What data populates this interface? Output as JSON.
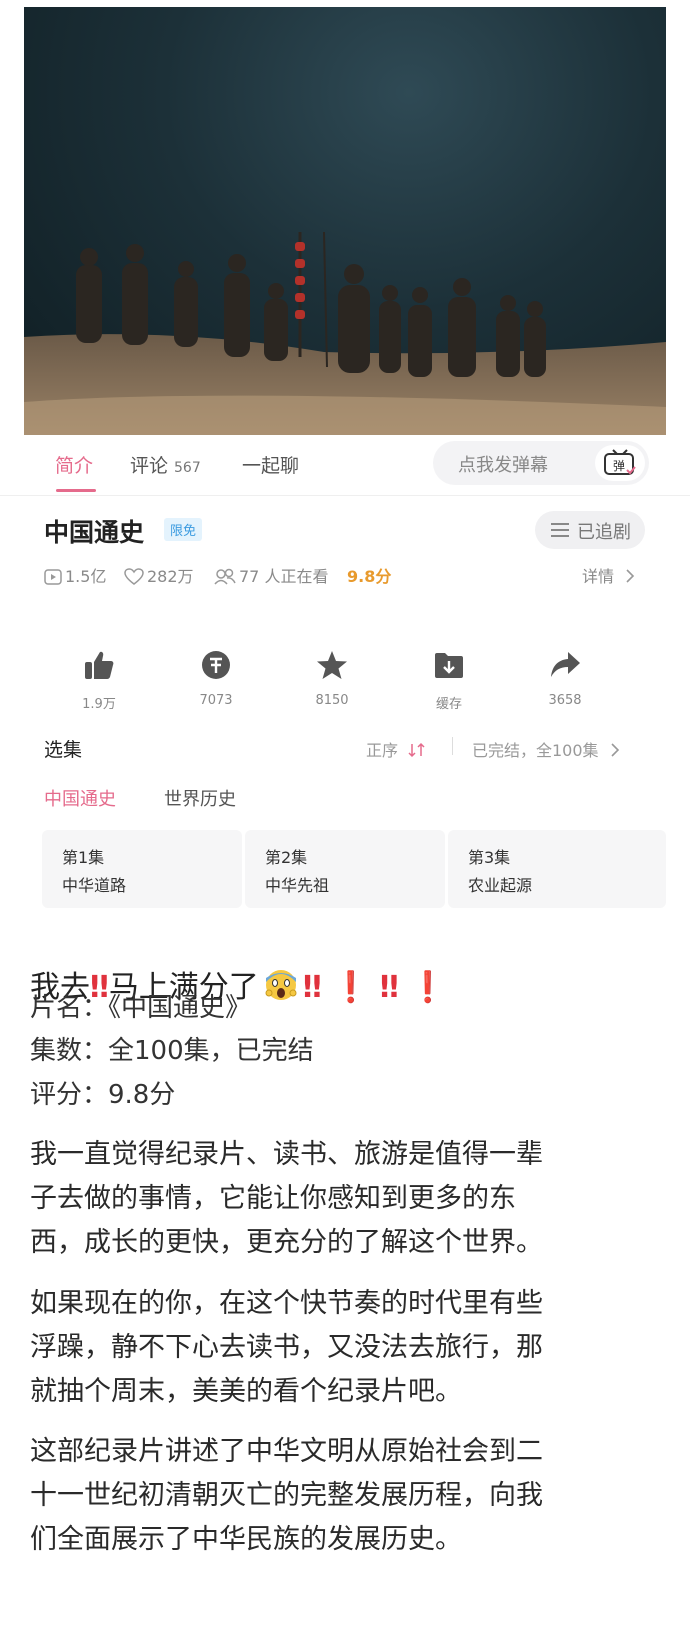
{
  "tabs": {
    "intro": "简介",
    "comments": "评论",
    "comments_count": "567",
    "chat": "一起聊",
    "danmaku_placeholder": "点我发弹幕",
    "danmaku_icon": "弹"
  },
  "show": {
    "title": "中国通史",
    "badge": "限免",
    "follow_label": "已追剧",
    "plays": "1.5亿",
    "likes": "282万",
    "watching": "77 人正在看",
    "score": "9.8分",
    "details": "详情"
  },
  "actions": [
    {
      "icon": "thumb-up-icon",
      "label": "1.9万"
    },
    {
      "icon": "coin-icon",
      "label": "7073"
    },
    {
      "icon": "star-icon",
      "label": "8150"
    },
    {
      "icon": "download-icon",
      "label": "缓存"
    },
    {
      "icon": "share-icon",
      "label": "3658"
    }
  ],
  "episodes": {
    "section_title": "选集",
    "order_label": "正序",
    "status": "已完结，全100集",
    "subtabs": [
      "中国通史",
      "世界历史"
    ],
    "cards": [
      {
        "num": "第1集",
        "title": "中华道路"
      },
      {
        "num": "第2集",
        "title": "中华先祖"
      },
      {
        "num": "第3集",
        "title": "农业起源"
      }
    ]
  },
  "post": {
    "headline_a": "我去",
    "headline_b": "马上满分了",
    "info_1": "片名：《中国通史》",
    "info_2": "集数：全100集，已完结",
    "info_3": "评分：9.8分",
    "para1_lines": [
      "我一直觉得纪录片、读书、旅游是值得一辈",
      "子去做的事情，它能让你感知到更多的东",
      "西，成长的更快，更充分的了解这个世界。"
    ],
    "para2_lines": [
      "如果现在的你，在这个快节奏的时代里有些",
      "浮躁，静不下心去读书，又没法去旅行，那",
      "就抽个周末，美美的看个纪录片吧。"
    ],
    "para3_lines": [
      "这部纪录片讲述了中华文明从原始社会到二",
      "十一世纪初清朝灭亡的完整发展历程，向我",
      "们全面展示了中华民族的发展历史。"
    ]
  },
  "colors": {
    "accent": "#e56b8c",
    "score": "#e89a2d",
    "badge": "#3b9be0"
  }
}
